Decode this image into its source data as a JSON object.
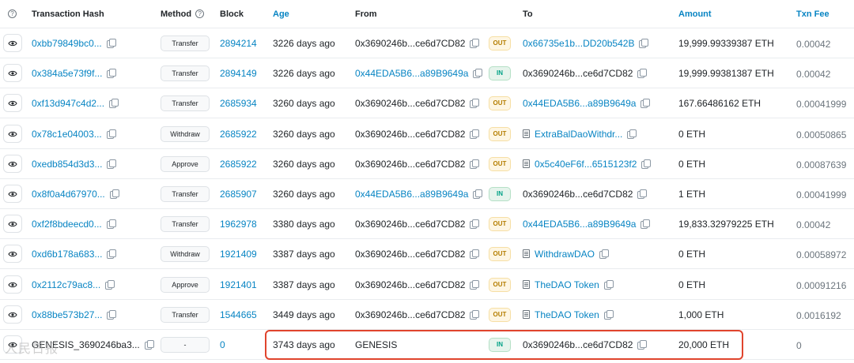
{
  "header": {
    "txn_hash": "Transaction Hash",
    "method": "Method",
    "block": "Block",
    "age": "Age",
    "from": "From",
    "to": "To",
    "amount": "Amount",
    "txn_fee": "Txn Fee"
  },
  "rows": [
    {
      "hash": "0xbb79849bc0...",
      "method": "Transfer",
      "block": "2894214",
      "age": "3226 days ago",
      "from": "0x3690246b...ce6d7CD82",
      "from_link": false,
      "dir": "OUT",
      "to": "0x66735e1b...DD20b542B",
      "to_link": true,
      "to_contract": false,
      "amount": "19,999.99339387 ETH",
      "fee": "0.00042"
    },
    {
      "hash": "0x384a5e73f9f...",
      "method": "Transfer",
      "block": "2894149",
      "age": "3226 days ago",
      "from": "0x44EDA5B6...a89B9649a",
      "from_link": true,
      "dir": "IN",
      "to": "0x3690246b...ce6d7CD82",
      "to_link": false,
      "to_contract": false,
      "amount": "19,999.99381387 ETH",
      "fee": "0.00042"
    },
    {
      "hash": "0xf13d947c4d2...",
      "method": "Transfer",
      "block": "2685934",
      "age": "3260 days ago",
      "from": "0x3690246b...ce6d7CD82",
      "from_link": false,
      "dir": "OUT",
      "to": "0x44EDA5B6...a89B9649a",
      "to_link": true,
      "to_contract": false,
      "amount": "167.66486162 ETH",
      "fee": "0.00041999"
    },
    {
      "hash": "0x78c1e04003...",
      "method": "Withdraw",
      "block": "2685922",
      "age": "3260 days ago",
      "from": "0x3690246b...ce6d7CD82",
      "from_link": false,
      "dir": "OUT",
      "to": "ExtraBalDaoWithdr...",
      "to_link": true,
      "to_contract": true,
      "amount": "0 ETH",
      "fee": "0.00050865"
    },
    {
      "hash": "0xedb854d3d3...",
      "method": "Approve",
      "block": "2685922",
      "age": "3260 days ago",
      "from": "0x3690246b...ce6d7CD82",
      "from_link": false,
      "dir": "OUT",
      "to": "0x5c40eF6f...6515123f2",
      "to_link": true,
      "to_contract": true,
      "amount": "0 ETH",
      "fee": "0.00087639"
    },
    {
      "hash": "0x8f0a4d67970...",
      "method": "Transfer",
      "block": "2685907",
      "age": "3260 days ago",
      "from": "0x44EDA5B6...a89B9649a",
      "from_link": true,
      "dir": "IN",
      "to": "0x3690246b...ce6d7CD82",
      "to_link": false,
      "to_contract": false,
      "amount": "1 ETH",
      "fee": "0.00041999"
    },
    {
      "hash": "0xf2f8bdeecd0...",
      "method": "Transfer",
      "block": "1962978",
      "age": "3380 days ago",
      "from": "0x3690246b...ce6d7CD82",
      "from_link": false,
      "dir": "OUT",
      "to": "0x44EDA5B6...a89B9649a",
      "to_link": true,
      "to_contract": false,
      "amount": "19,833.32979225 ETH",
      "fee": "0.00042"
    },
    {
      "hash": "0xd6b178a683...",
      "method": "Withdraw",
      "block": "1921409",
      "age": "3387 days ago",
      "from": "0x3690246b...ce6d7CD82",
      "from_link": false,
      "dir": "OUT",
      "to": "WithdrawDAO",
      "to_link": true,
      "to_contract": true,
      "amount": "0 ETH",
      "fee": "0.00058972"
    },
    {
      "hash": "0x2112c79ac8...",
      "method": "Approve",
      "block": "1921401",
      "age": "3387 days ago",
      "from": "0x3690246b...ce6d7CD82",
      "from_link": false,
      "dir": "OUT",
      "to": "TheDAO Token",
      "to_link": true,
      "to_contract": true,
      "amount": "0 ETH",
      "fee": "0.00091216"
    },
    {
      "hash": "0x88be573b27...",
      "method": "Transfer",
      "block": "1544665",
      "age": "3449 days ago",
      "from": "0x3690246b...ce6d7CD82",
      "from_link": false,
      "dir": "OUT",
      "to": "TheDAO Token",
      "to_link": true,
      "to_contract": true,
      "amount": "1,000 ETH",
      "fee": "0.0016192"
    },
    {
      "hash": "GENESIS_3690246ba3...",
      "method": "-",
      "block": "0",
      "age": "3743 days ago",
      "from": "GENESIS",
      "from_link": false,
      "dir": "IN",
      "to": "0x3690246b...ce6d7CD82",
      "to_link": false,
      "to_contract": false,
      "amount": "20,000 ETH",
      "fee": "0"
    }
  ],
  "watermark": "人民日报",
  "colors": {
    "link": "#0784c3",
    "highlight": "#e0442d",
    "out_badge": "#b47d00",
    "in_badge": "#00a186"
  }
}
